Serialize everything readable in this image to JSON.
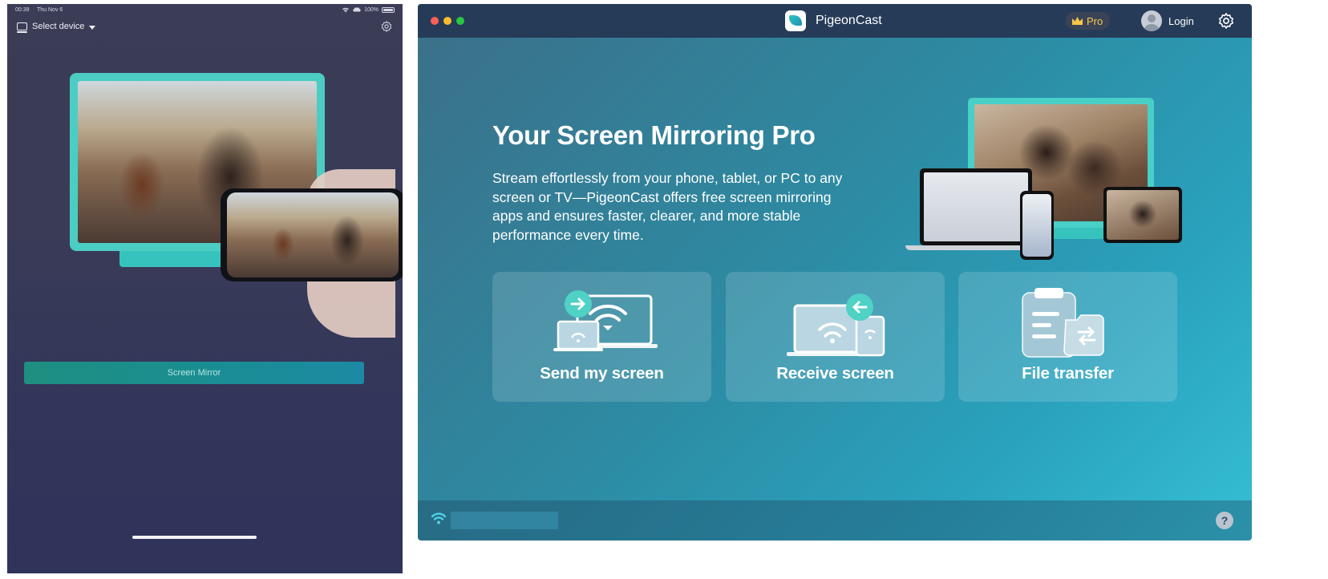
{
  "ipad": {
    "status": {
      "time": "00:39",
      "date": "Thu Nov 6",
      "battery": "100%"
    },
    "select_device_label": "Select device",
    "screen_mirror_label": "Screen Mirror"
  },
  "mac": {
    "app_title": "PigeonCast",
    "pro_label": "Pro",
    "login_label": "Login",
    "headline": "Your Screen Mirroring Pro",
    "description": "Stream effortlessly from your phone, tablet, or PC to any screen or TV—PigeonCast offers free screen mirroring apps and ensures faster, clearer, and more stable performance every time.",
    "cards": [
      {
        "label": "Send my screen"
      },
      {
        "label": "Receive screen"
      },
      {
        "label": "File transfer"
      }
    ],
    "help_label": "?"
  },
  "colors": {
    "accent_teal": "#4ccdc4",
    "mac_titlebar": "#263b58",
    "pro_gold": "#f7c948",
    "arrow_badge": "#4fd1c5"
  },
  "icons": [
    "device-icon",
    "caret-down-icon",
    "gear-icon",
    "crown-icon",
    "avatar-icon",
    "wifi-icon",
    "help-icon",
    "arrow-right-icon",
    "arrow-left-icon",
    "clipboard-icon",
    "swap-arrows-icon"
  ]
}
